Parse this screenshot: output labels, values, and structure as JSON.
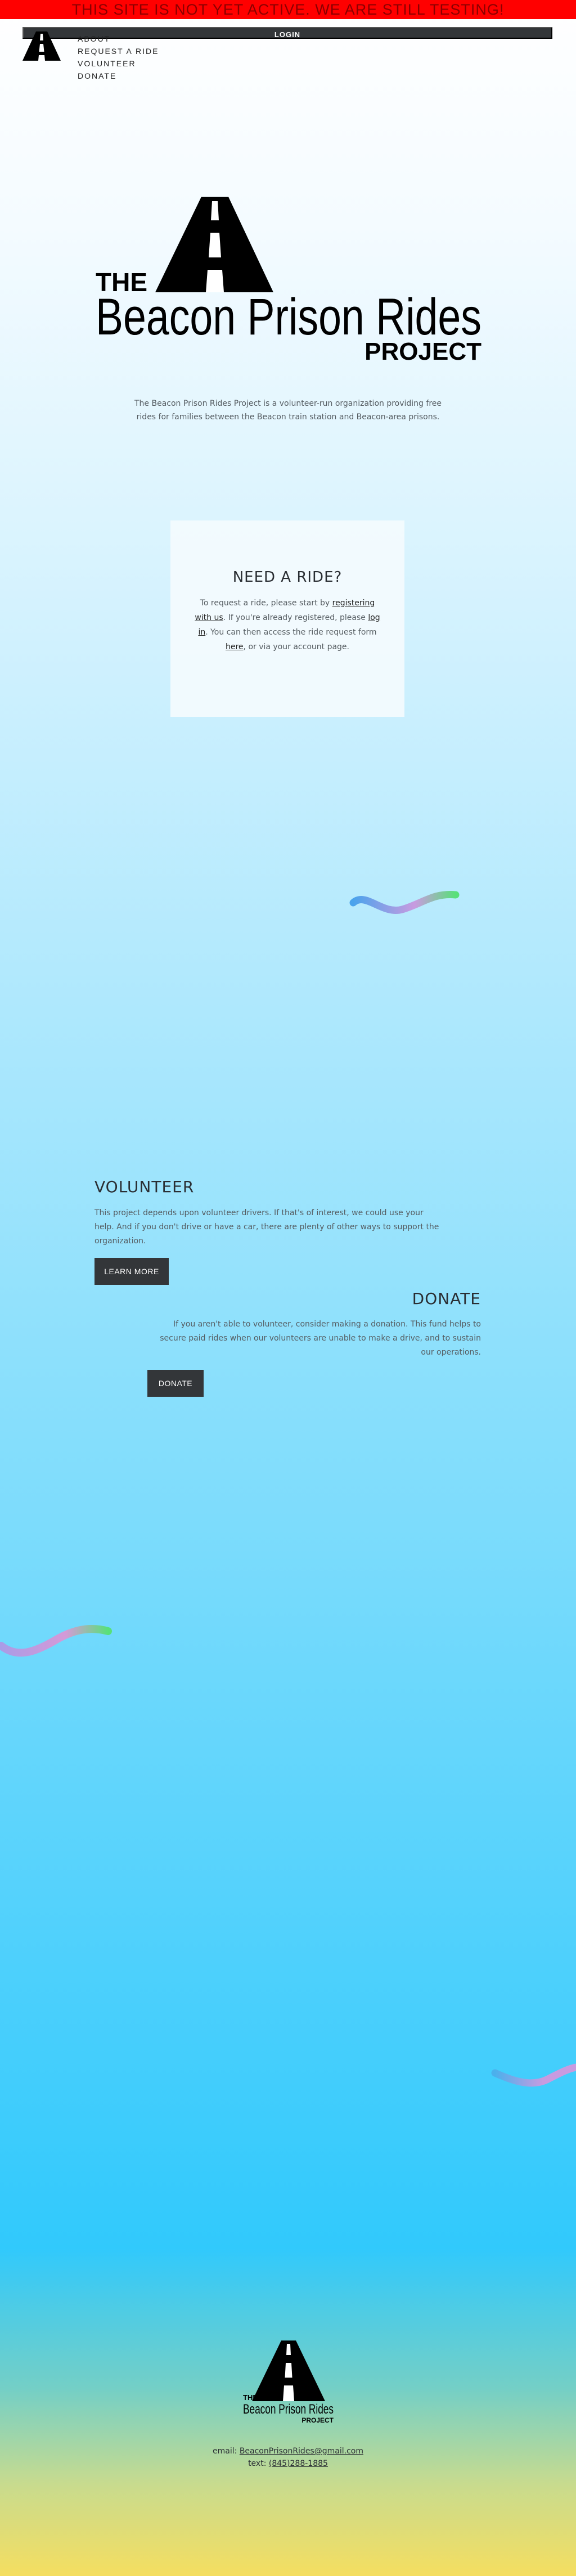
{
  "banner": {
    "text": "THIS SITE IS NOT YET ACTIVE. WE ARE STILL TESTING!"
  },
  "header": {
    "login_label": "LOGIN",
    "nav": [
      "ABOUT",
      "REQUEST A RIDE",
      "VOLUNTEER",
      "DONATE"
    ]
  },
  "logo": {
    "the": "THE",
    "name": "Beacon Prison Rides",
    "project": "PROJECT"
  },
  "hero": {
    "text": "The Beacon Prison Rides Project is a volunteer-run organization providing free rides for families between the Beacon train station and Beacon-area prisons."
  },
  "ride": {
    "title": "NEED A RIDE?",
    "p1": "To request a ride, please start by ",
    "link_register": "registering with us",
    "p2": ". If you're already registered, please ",
    "link_login": "log in",
    "p3": ". You can then access the ride request form ",
    "link_here": "here",
    "p4": ", or via your account page."
  },
  "volunteer": {
    "title": "VOLUNTEER",
    "text": "This project depends upon volunteer drivers. If that's of interest, we could use your help. And if you don't drive or have a car, there are plenty of other ways to support the organization.",
    "button": "LEARN MORE"
  },
  "donate": {
    "title": "DONATE",
    "text": "If you aren't able to volunteer, consider making a donation. This fund helps to secure paid rides when our volunteers are unable to make a drive, and to sustain our operations.",
    "button": "DONATE"
  },
  "footer": {
    "email_label": "email: ",
    "email": "BeaconPrisonRides@gmail.com",
    "text_label": "text: ",
    "phone": "(845)288-1885"
  },
  "colors": {
    "banner_bg": "#ff0000",
    "banner_text": "#8b0000",
    "button_bg": "#333639",
    "squiggle_start": "#4aa3ec",
    "squiggle_mid": "#c89be0",
    "squiggle_end": "#58e07a"
  }
}
